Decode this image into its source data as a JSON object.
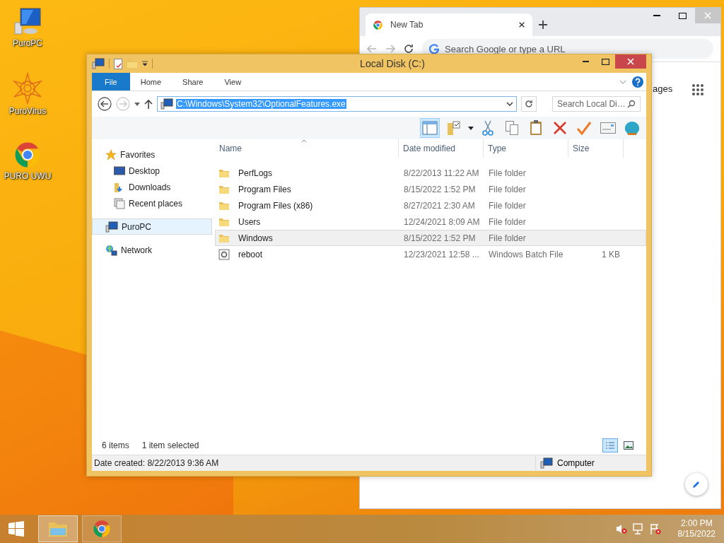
{
  "desktop_icons": [
    {
      "label": "PuroPC",
      "kind": "computer"
    },
    {
      "label": "PuroVirus",
      "kind": "virus"
    },
    {
      "label": "PURO UWU",
      "kind": "chrome"
    }
  ],
  "browser": {
    "tab_title": "New Tab",
    "omnibox": {
      "placeholder": "Search Google or type a URL"
    },
    "page_link": "ages"
  },
  "explorer": {
    "title": "Local Disk (C:)",
    "ribbon_tabs": [
      {
        "label": "File",
        "kind": "file"
      },
      {
        "label": "Home",
        "kind": "tab"
      },
      {
        "label": "Share",
        "kind": "tab"
      },
      {
        "label": "View",
        "kind": "tab"
      }
    ],
    "address": {
      "value": "C:\\Windows\\System32\\OptionalFeatures.exe"
    },
    "search": {
      "placeholder": "Search Local Di…"
    },
    "nav": [
      {
        "label": "Favorites",
        "kind": "favorites",
        "selected": false,
        "children": [
          {
            "label": "Desktop",
            "kind": "desktop",
            "selected": false
          },
          {
            "label": "Downloads",
            "kind": "downloads",
            "selected": false
          },
          {
            "label": "Recent places",
            "kind": "recent",
            "selected": false
          }
        ]
      },
      {
        "label": "PuroPC",
        "kind": "computer",
        "selected": true
      },
      {
        "label": "Network",
        "kind": "network",
        "selected": false
      }
    ],
    "columns": [
      "Name",
      "Date modified",
      "Type",
      "Size"
    ],
    "rows": [
      {
        "name": "PerfLogs",
        "date": "8/22/2013 11:22 AM",
        "type": "File folder",
        "kind": "folder",
        "selected": false
      },
      {
        "name": "Program Files",
        "date": "8/15/2022 1:52 PM",
        "type": "File folder",
        "kind": "folder",
        "selected": false
      },
      {
        "name": "Program Files (x86)",
        "date": "8/27/2021 2:30 AM",
        "type": "File folder",
        "kind": "folder",
        "selected": false
      },
      {
        "name": "Users",
        "date": "12/24/2021 8:09 AM",
        "type": "File folder",
        "kind": "folder",
        "selected": false
      },
      {
        "name": "Windows",
        "date": "8/15/2022 1:52 PM",
        "type": "File folder",
        "kind": "folder",
        "selected": true
      },
      {
        "name": "reboot",
        "date": "12/23/2021 12:58 ...",
        "type": "Windows Batch File",
        "size": "1 KB",
        "kind": "batch",
        "selected": false
      }
    ],
    "item_count": "6 items",
    "selection_info": "1 item selected",
    "views": [
      {
        "kind": "details",
        "selected": true
      },
      {
        "kind": "thumbnails",
        "selected": false
      }
    ],
    "status": {
      "date_created": "Date created: 8/22/2013 9:36 AM",
      "location": "Computer"
    }
  },
  "taskbar": {
    "apps": [
      {
        "kind": "explorer",
        "active": true
      },
      {
        "kind": "chrome",
        "active": false
      }
    ],
    "time": "2:00 PM",
    "date": "8/15/2022"
  }
}
